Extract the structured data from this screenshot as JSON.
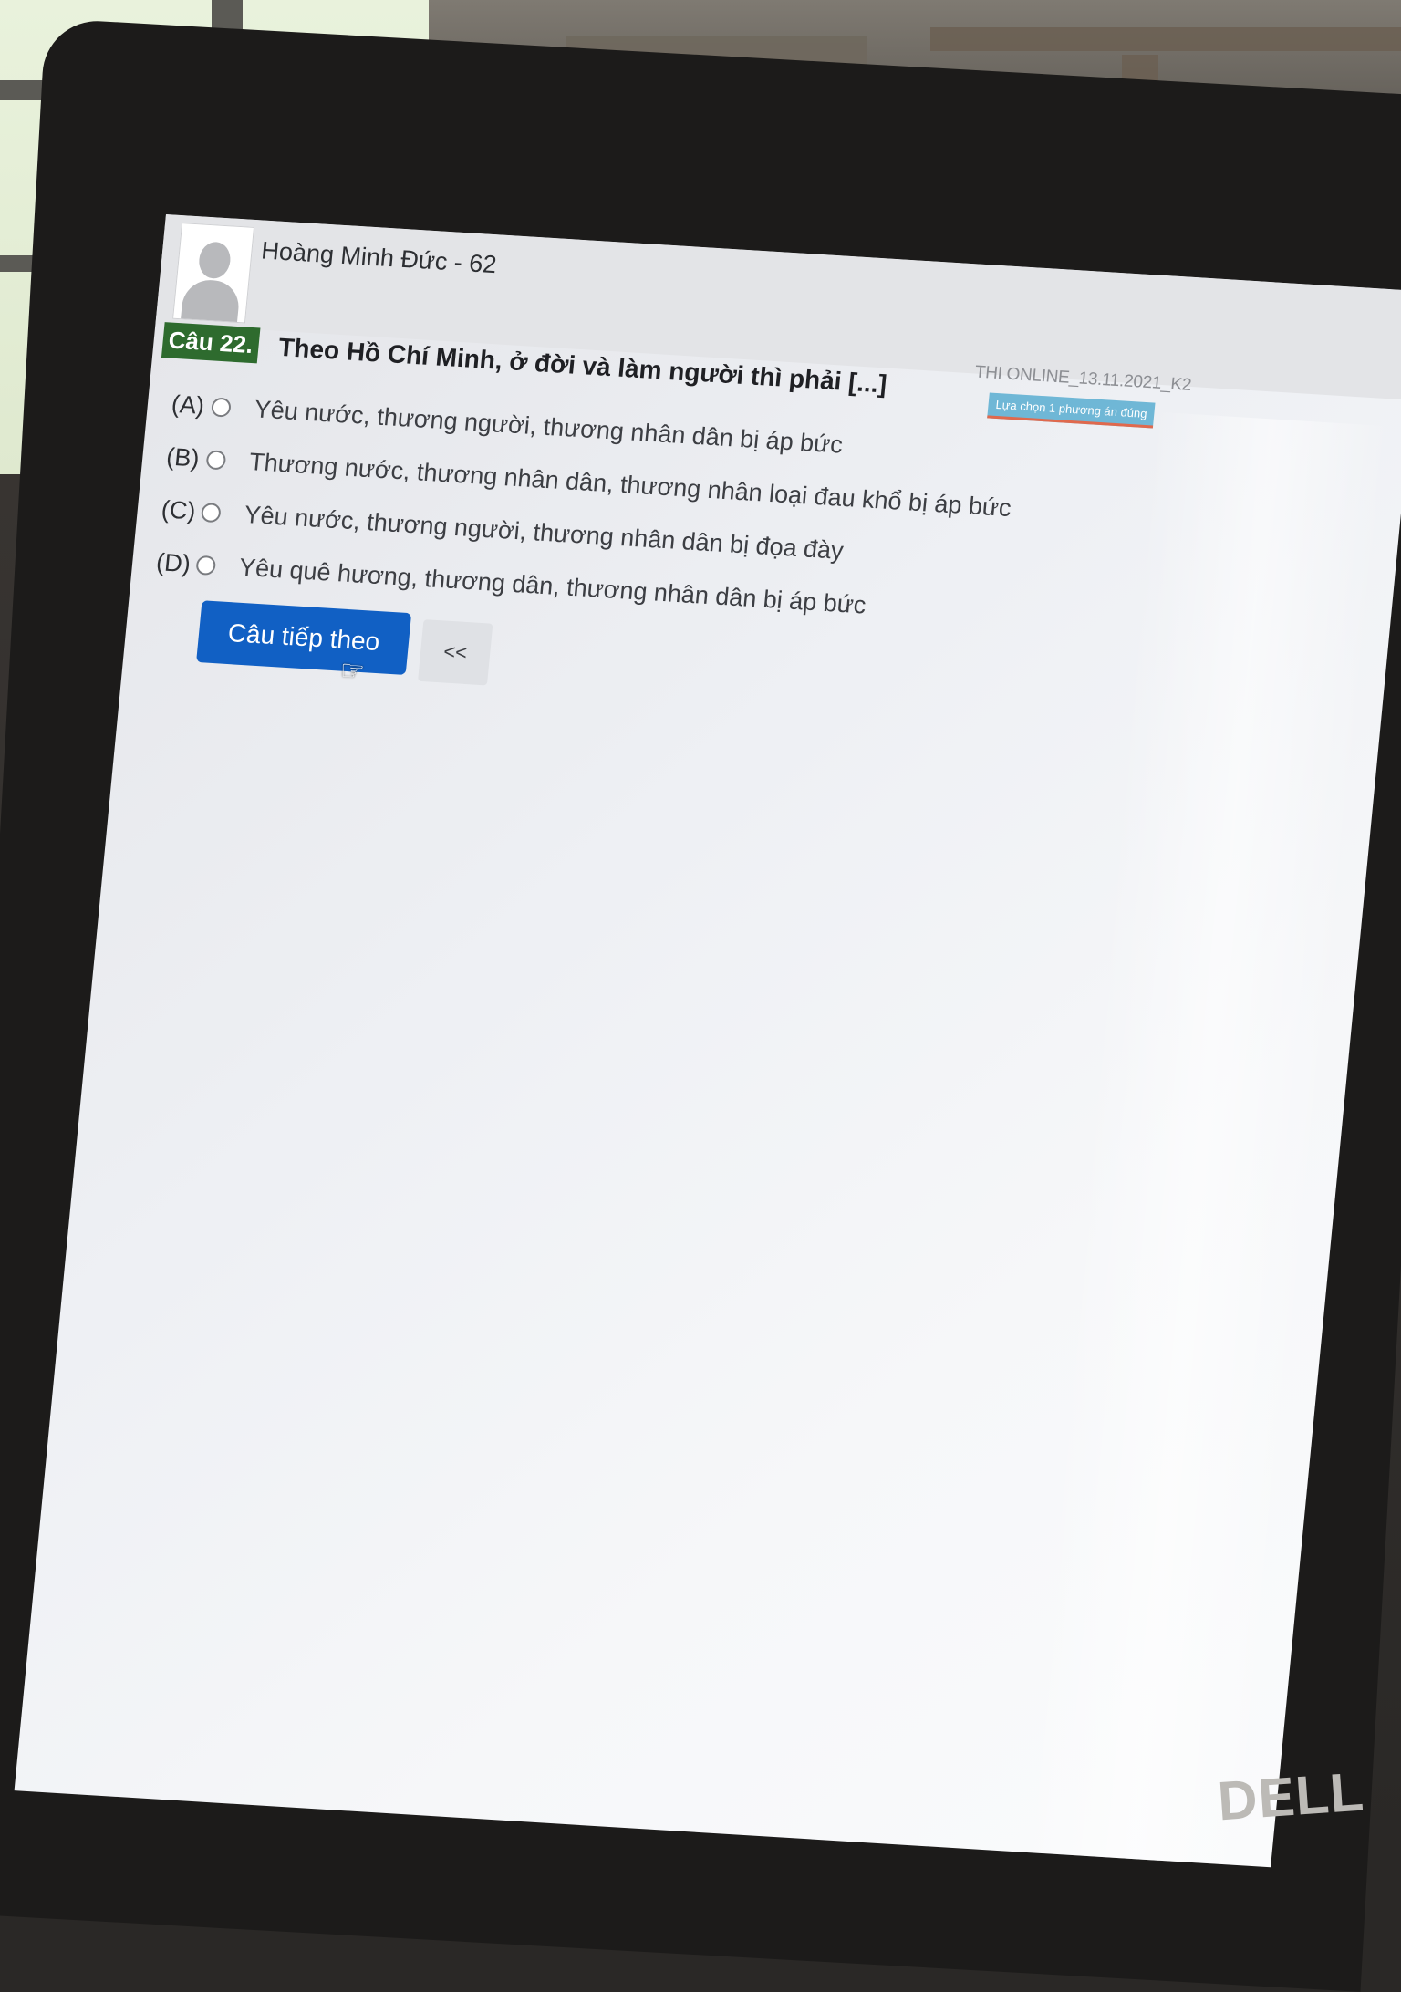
{
  "student": {
    "name": "Hoàng Minh Đức - 62"
  },
  "exam": {
    "title": "THI ONLINE_13.11.2021_K2",
    "instruction": "Lựa chọn 1 phương án đúng"
  },
  "question": {
    "number": "Câu 22.",
    "text": "Theo Hồ Chí Minh, ở đời và làm người thì phải [...]",
    "options": [
      {
        "letter": "(A)",
        "text": "Yêu nước, thương người, thương nhân dân bị áp bức"
      },
      {
        "letter": "(B)",
        "text": "Thương nước, thương nhân dân, thương nhân loại đau khổ bị áp bức"
      },
      {
        "letter": "(C)",
        "text": "Yêu nước, thương người, thương nhân dân bị đọa đày"
      },
      {
        "letter": "(D)",
        "text": "Yêu quê hương, thương dân, thương nhân dân bị áp bức"
      }
    ]
  },
  "navigation": {
    "next_label": "Câu tiếp theo",
    "prev_label": "<<"
  },
  "device": {
    "brand": "DELL"
  },
  "colors": {
    "question_number_bg": "#2e6b2e",
    "next_button_bg": "#1160c4",
    "instruction_bg": "#6fb7d6"
  }
}
